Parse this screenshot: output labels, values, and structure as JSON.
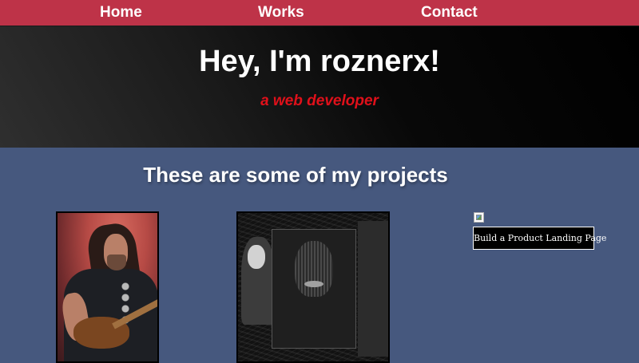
{
  "nav": {
    "home_label": "Home",
    "works_label": "Works",
    "contact_label": "Contact",
    "background_color": "#be3348"
  },
  "hero": {
    "title": "Hey, I'm roznerx!",
    "subtitle": "a web developer",
    "subtitle_color": "#e0101a"
  },
  "projects": {
    "heading": "These are some of my projects",
    "background_color": "#46587e",
    "items": [
      {
        "kind": "image",
        "icon": "musician-photo"
      },
      {
        "kind": "image",
        "icon": "portrait-artwork"
      },
      {
        "kind": "broken-image-with-button",
        "icon": "broken-image-icon",
        "button_label": "Build a Product Landing Page"
      }
    ]
  }
}
